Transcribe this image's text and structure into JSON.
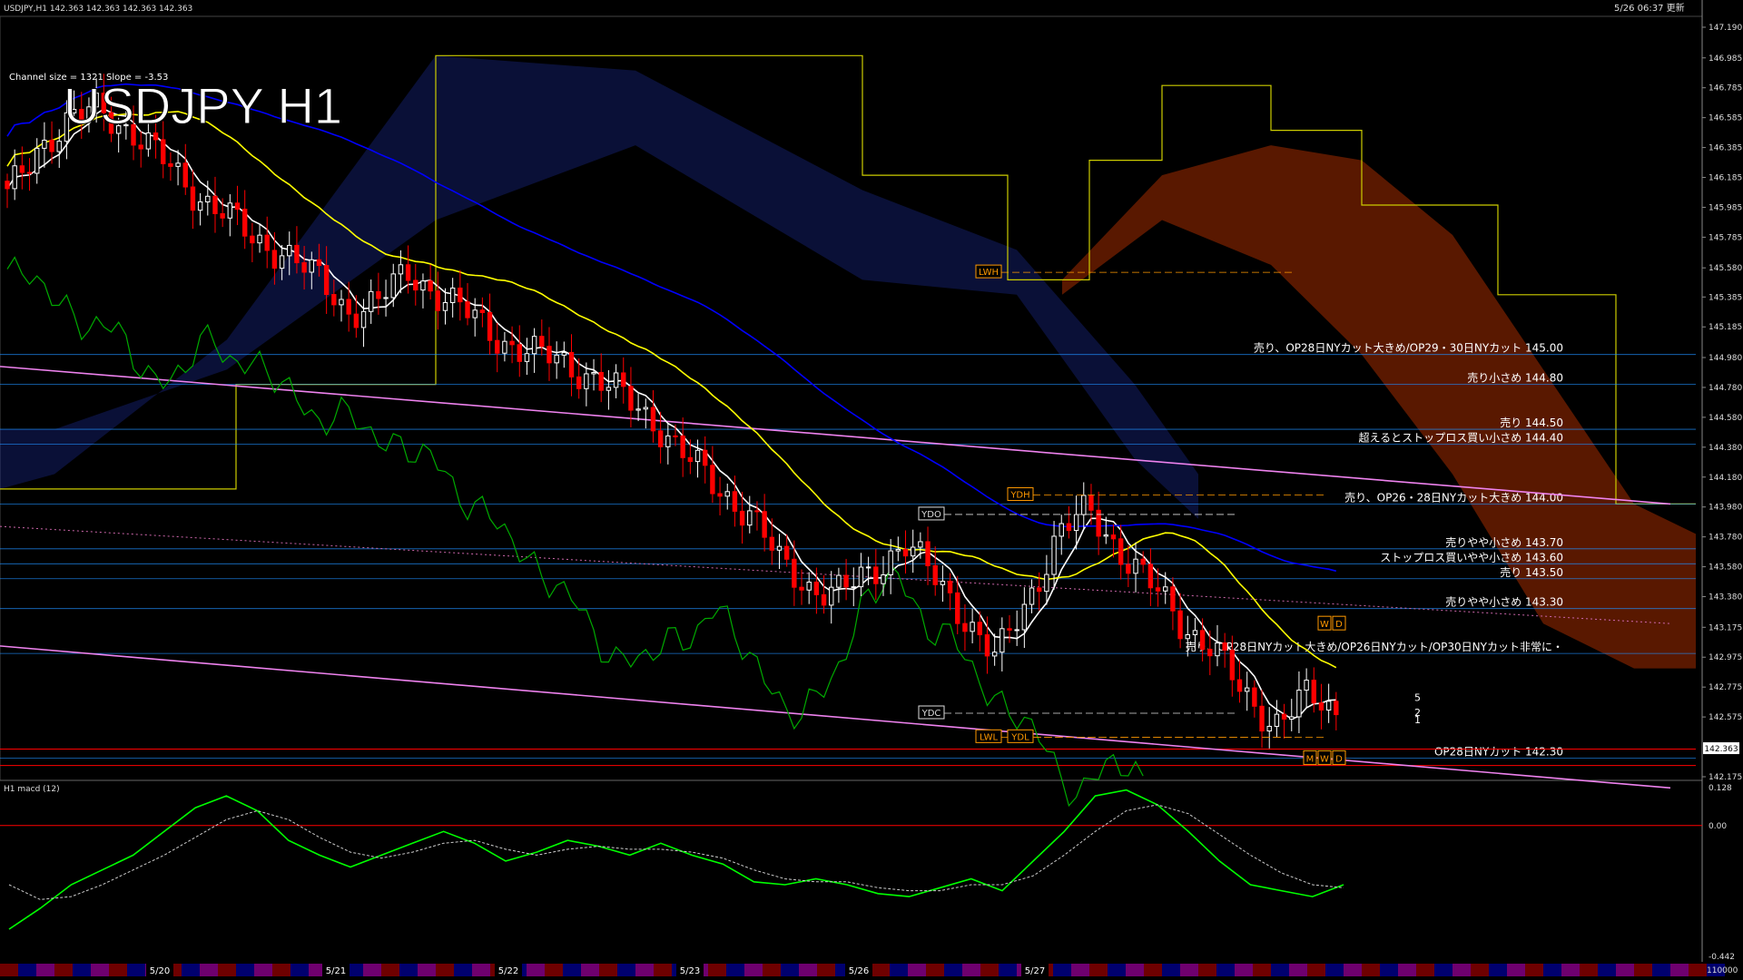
{
  "header": {
    "symbol_line": "USDJPY,H1  142.363 142.363 142.363 142.363",
    "big_title": "USDJPY H1",
    "channel_info": "Channel size = 1321 Slope = -3.53",
    "timestamp": "5/26 06:37 更新"
  },
  "colors": {
    "background": "#000000",
    "bull_candle": "#ffffff",
    "bear_candle": "#ff0000",
    "kumo_bear": "#1e2f9e",
    "kumo_bull": "#ff4500",
    "ma_fast": "#ffffff",
    "ma_mid": "#ffff00",
    "ma_slow": "#0000ff",
    "chikou": "#00aa00",
    "span_line": "#cccc00",
    "channel": "#ee82ee",
    "level_line": "#1e90ff",
    "macd": "#00ff00",
    "signal": "#cccccc"
  },
  "chart_data": [
    {
      "type": "candlestick",
      "title": "USDJPY H1",
      "ylim": [
        142.175,
        147.19
      ],
      "y_ticks": [
        "147.190",
        "146.985",
        "146.785",
        "146.585",
        "146.385",
        "146.185",
        "145.985",
        "145.785",
        "145.580",
        "145.385",
        "145.185",
        "144.980",
        "144.780",
        "144.580",
        "144.380",
        "144.180",
        "143.980",
        "143.780",
        "143.580",
        "143.380",
        "143.175",
        "142.975",
        "142.775",
        "142.575",
        "142.363",
        "142.175"
      ],
      "x_labels": [
        "5/20",
        "5/21",
        "5/22",
        "5/23",
        "5/26",
        "5/27"
      ],
      "current_price": "142.363",
      "close_path": [
        146.05,
        146.4,
        146.55,
        146.65,
        146.5,
        146.3,
        146.1,
        145.95,
        145.75,
        145.7,
        145.5,
        145.3,
        145.35,
        145.55,
        145.4,
        145.25,
        145.1,
        145.0,
        144.95,
        144.85,
        144.7,
        144.55,
        144.3,
        144.1,
        143.95,
        143.6,
        143.45,
        143.4,
        143.55,
        143.75,
        143.5,
        143.25,
        142.95,
        143.35,
        143.8,
        143.95,
        143.7,
        143.45,
        143.2,
        143.05,
        142.7,
        142.55,
        142.7,
        142.6
      ],
      "levels": [
        {
          "label": "売り、OP28日NYカット大きめ/OP29・30日NYカット 145.00",
          "price": 145.0
        },
        {
          "label": "売り小さめ 144.80",
          "price": 144.8
        },
        {
          "label": "売り 144.50",
          "price": 144.5
        },
        {
          "label": "超えるとストップロス買い小さめ 144.40",
          "price": 144.4
        },
        {
          "label": "売り、OP26・28日NYカット大きめ 144.00",
          "price": 144.0
        },
        {
          "label": "売りやや小さめ 143.70",
          "price": 143.7
        },
        {
          "label": "ストップロス買いやや小さめ 143.60",
          "price": 143.6
        },
        {
          "label": "売り 143.50",
          "price": 143.5
        },
        {
          "label": "売りやや小さめ 143.30",
          "price": 143.3
        },
        {
          "label": "売り、OP28日NYカット大きめ/OP26日NYカット/OP30日NYカット非常に・",
          "price": 143.0
        },
        {
          "label": "OP28日NYカット 142.30",
          "price": 142.3
        }
      ],
      "markers": [
        {
          "label": "LWH",
          "price": 145.55
        },
        {
          "label": "YDH",
          "price": 144.06
        },
        {
          "label": "YDO",
          "price": 143.93
        },
        {
          "label": "YDC",
          "price": 142.6
        },
        {
          "label": "LWL",
          "price": 142.44
        },
        {
          "label": "YDL",
          "price": 142.44
        }
      ],
      "period_boxes": [
        "W",
        "D",
        "M",
        "W",
        "D"
      ],
      "projection_labels": [
        "5",
        "2",
        "1"
      ]
    },
    {
      "type": "line",
      "title": "H1  macd (12)",
      "ylim": [
        -0.442,
        0.128
      ],
      "y_ticks": [
        "0.128",
        "0.00",
        "-0.442"
      ],
      "bottom_label": "110000",
      "macd": [
        -0.35,
        -0.28,
        -0.2,
        -0.15,
        -0.1,
        -0.02,
        0.06,
        0.1,
        0.05,
        -0.05,
        -0.1,
        -0.14,
        -0.1,
        -0.06,
        -0.02,
        -0.06,
        -0.12,
        -0.09,
        -0.05,
        -0.07,
        -0.1,
        -0.06,
        -0.1,
        -0.13,
        -0.19,
        -0.2,
        -0.18,
        -0.2,
        -0.23,
        -0.24,
        -0.21,
        -0.18,
        -0.22,
        -0.12,
        -0.02,
        0.1,
        0.12,
        0.07,
        -0.02,
        -0.12,
        -0.2,
        -0.22,
        -0.24,
        -0.2
      ],
      "signal": [
        -0.2,
        -0.25,
        -0.24,
        -0.2,
        -0.15,
        -0.1,
        -0.04,
        0.02,
        0.05,
        0.02,
        -0.04,
        -0.09,
        -0.11,
        -0.09,
        -0.06,
        -0.05,
        -0.08,
        -0.1,
        -0.08,
        -0.07,
        -0.08,
        -0.08,
        -0.09,
        -0.11,
        -0.15,
        -0.18,
        -0.19,
        -0.19,
        -0.21,
        -0.22,
        -0.22,
        -0.2,
        -0.2,
        -0.17,
        -0.1,
        -0.02,
        0.05,
        0.07,
        0.04,
        -0.03,
        -0.1,
        -0.16,
        -0.2,
        -0.21
      ]
    }
  ]
}
